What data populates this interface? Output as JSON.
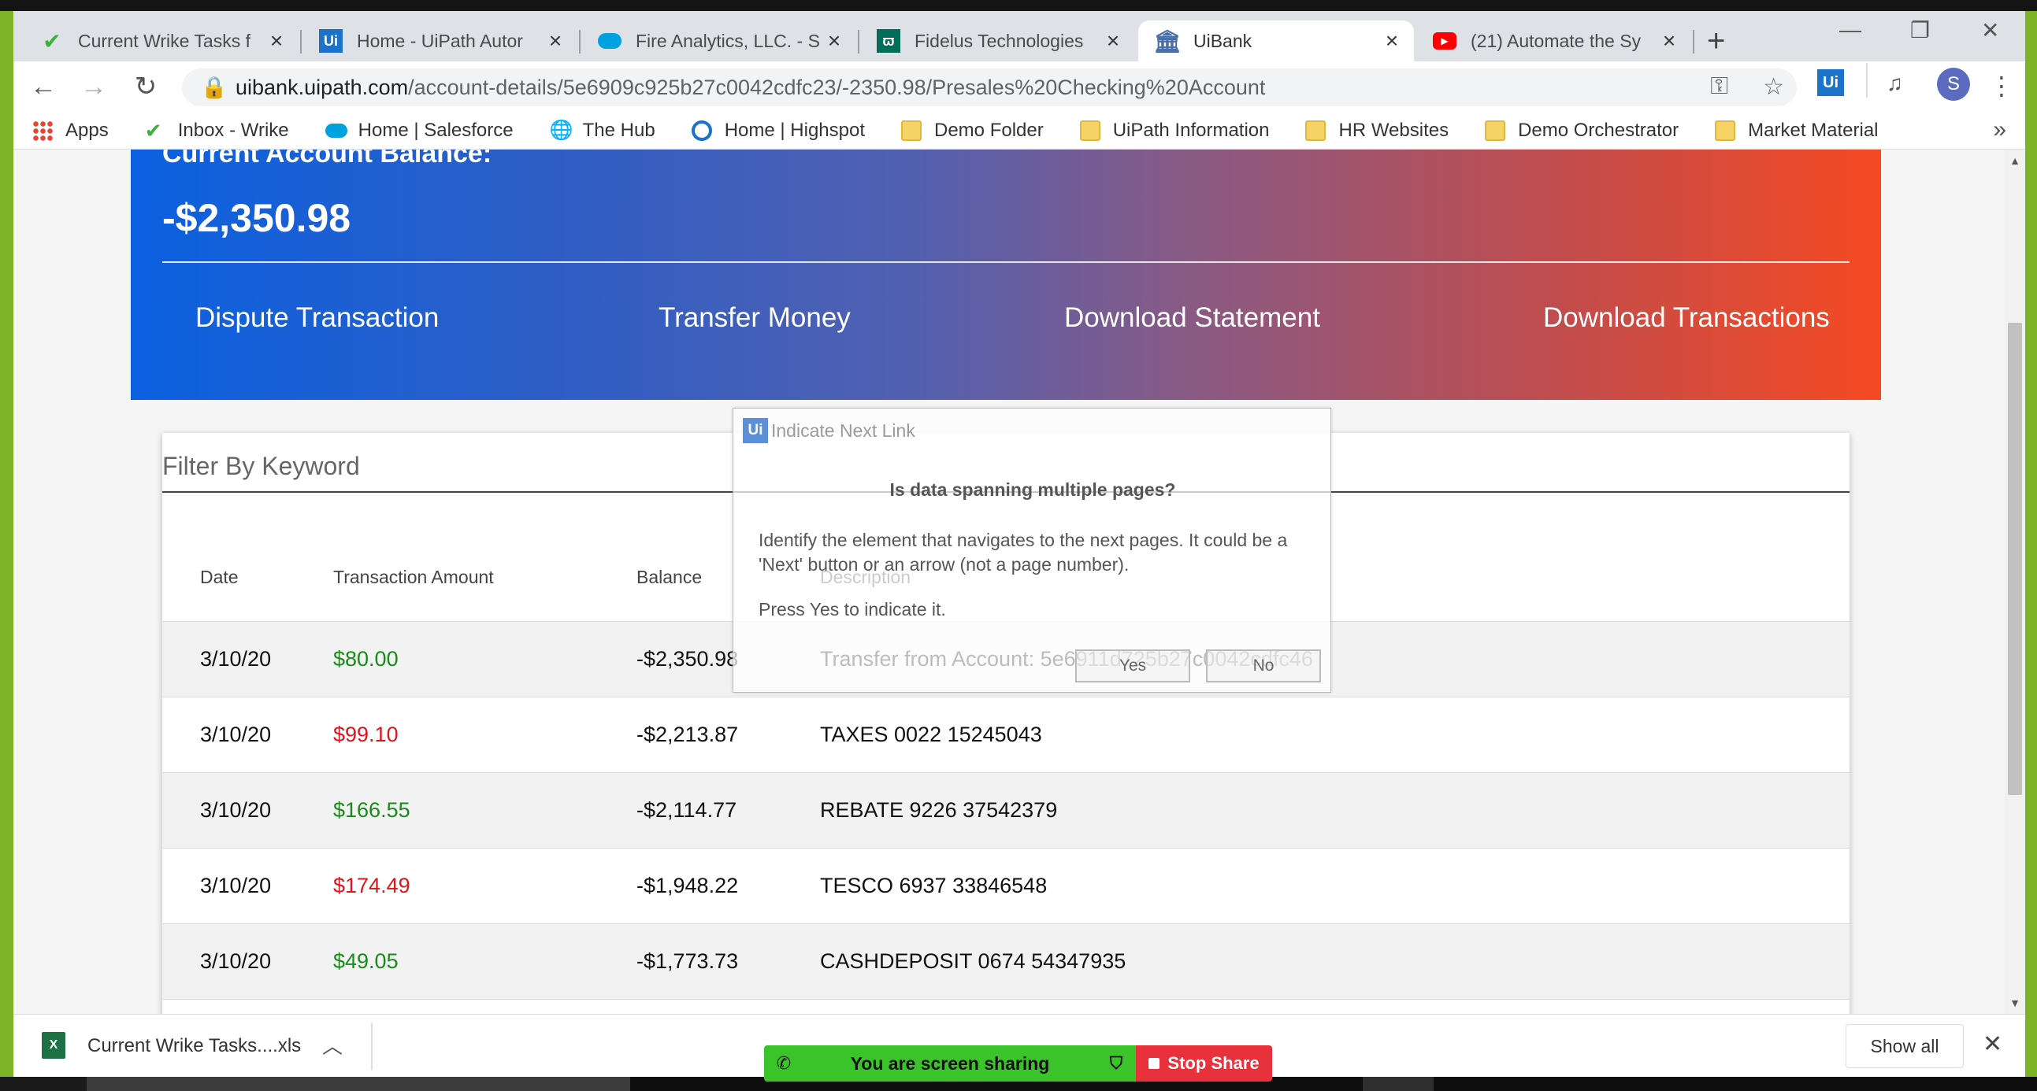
{
  "tabs": [
    {
      "label": "Current Wrike Tasks f",
      "icon": "wrike-check-icon",
      "active": false
    },
    {
      "label": "Home - UiPath Autor",
      "icon": "uipath-icon",
      "active": false
    },
    {
      "label": "Fire Analytics, LLC. - S",
      "icon": "salesforce-cloud-icon",
      "active": false
    },
    {
      "label": "Fidelus Technologies",
      "icon": "fidelus-icon",
      "active": false
    },
    {
      "label": "UiBank",
      "icon": "bank-icon",
      "active": true
    },
    {
      "label": "(21) Automate the Sy",
      "icon": "youtube-icon",
      "active": false
    }
  ],
  "address": {
    "host": "uibank.uipath.com",
    "path": "/account-details/5e6909c925b27c0042cdfc23/-2350.98/Presales%20Checking%20Account"
  },
  "bookmarks": [
    {
      "label": "Apps",
      "icon": "apps-grid-icon"
    },
    {
      "label": "Inbox - Wrike",
      "icon": "wrike-check-icon"
    },
    {
      "label": "Home | Salesforce",
      "icon": "salesforce-cloud-icon"
    },
    {
      "label": "The Hub",
      "icon": "globe-icon"
    },
    {
      "label": "Home | Highspot",
      "icon": "highspot-icon"
    },
    {
      "label": "Demo Folder",
      "icon": "folder-icon"
    },
    {
      "label": "UiPath Information",
      "icon": "folder-icon"
    },
    {
      "label": "HR Websites",
      "icon": "folder-icon"
    },
    {
      "label": "Demo Orchestrator",
      "icon": "folder-icon"
    },
    {
      "label": "Market Material",
      "icon": "folder-icon"
    }
  ],
  "profile_initial": "S",
  "ext_label": "Ui",
  "account": {
    "balance_label": "Current Account Balance:",
    "balance": "-$2,350.98",
    "actions": [
      "Dispute Transaction",
      "Transfer Money",
      "Download Statement",
      "Download Transactions"
    ]
  },
  "filter_placeholder": "Filter By Keyword",
  "table": {
    "headers": [
      "Date",
      "Transaction Amount",
      "Balance",
      "Description"
    ],
    "rows": [
      {
        "date": "3/10/20",
        "amount": "$80.00",
        "type": "credit",
        "balance": "-$2,350.98",
        "description": "Transfer from Account: 5e6911d725b27c0042cdfc46"
      },
      {
        "date": "3/10/20",
        "amount": "$99.10",
        "type": "debit",
        "balance": "-$2,213.87",
        "description": "TAXES 0022 15245043"
      },
      {
        "date": "3/10/20",
        "amount": "$166.55",
        "type": "credit",
        "balance": "-$2,114.77",
        "description": "REBATE 9226 37542379"
      },
      {
        "date": "3/10/20",
        "amount": "$174.49",
        "type": "debit",
        "balance": "-$1,948.22",
        "description": "TESCO 6937 33846548"
      },
      {
        "date": "3/10/20",
        "amount": "$49.05",
        "type": "credit",
        "balance": "-$1,773.73",
        "description": "CASHDEPOSIT 0674 54347935"
      }
    ]
  },
  "dialog": {
    "logo": "Ui",
    "title": "Indicate Next Link",
    "heading": "Is data spanning multiple pages?",
    "body": "Identify the element that navigates to the next pages. It could be a 'Next' button or an arrow (not a page number).",
    "body2": "Press Yes to indicate it.",
    "yes": "Yes",
    "no": "No"
  },
  "download": {
    "filename": "Current Wrike Tasks....xls",
    "show_all": "Show all"
  },
  "screenshare": {
    "status": "You are screen sharing",
    "stop": "Stop Share"
  },
  "colors": {
    "credit": "#1a8a1a",
    "debit": "#e0151c",
    "gradient_start": "#0b60e0",
    "gradient_end": "#f54a22"
  }
}
